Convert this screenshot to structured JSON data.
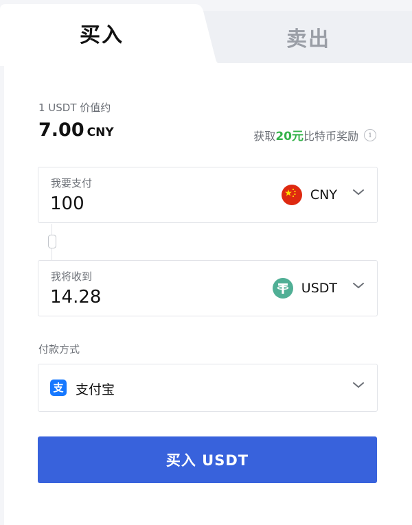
{
  "tabs": {
    "buy": "买入",
    "sell": "卖出"
  },
  "rate": {
    "label": "1 USDT 价值约",
    "value": "7.00",
    "unit": "CNY"
  },
  "promo": {
    "prefix": "获取",
    "highlight": "20元",
    "suffix": "比特币奖励",
    "info": "i"
  },
  "pay_field": {
    "label": "我要支付",
    "value": "100",
    "currency": "CNY"
  },
  "receive_field": {
    "label": "我将收到",
    "value": "14.28",
    "currency": "USDT"
  },
  "payment": {
    "label": "付款方式",
    "method": "支付宝",
    "icon_glyph": "支"
  },
  "buy_button": "买入 USDT",
  "colors": {
    "accent": "#3862dc",
    "promo_green": "#34b34a",
    "cny_flag": "#de2910",
    "usdt": "#50af95",
    "alipay": "#1678ff"
  }
}
